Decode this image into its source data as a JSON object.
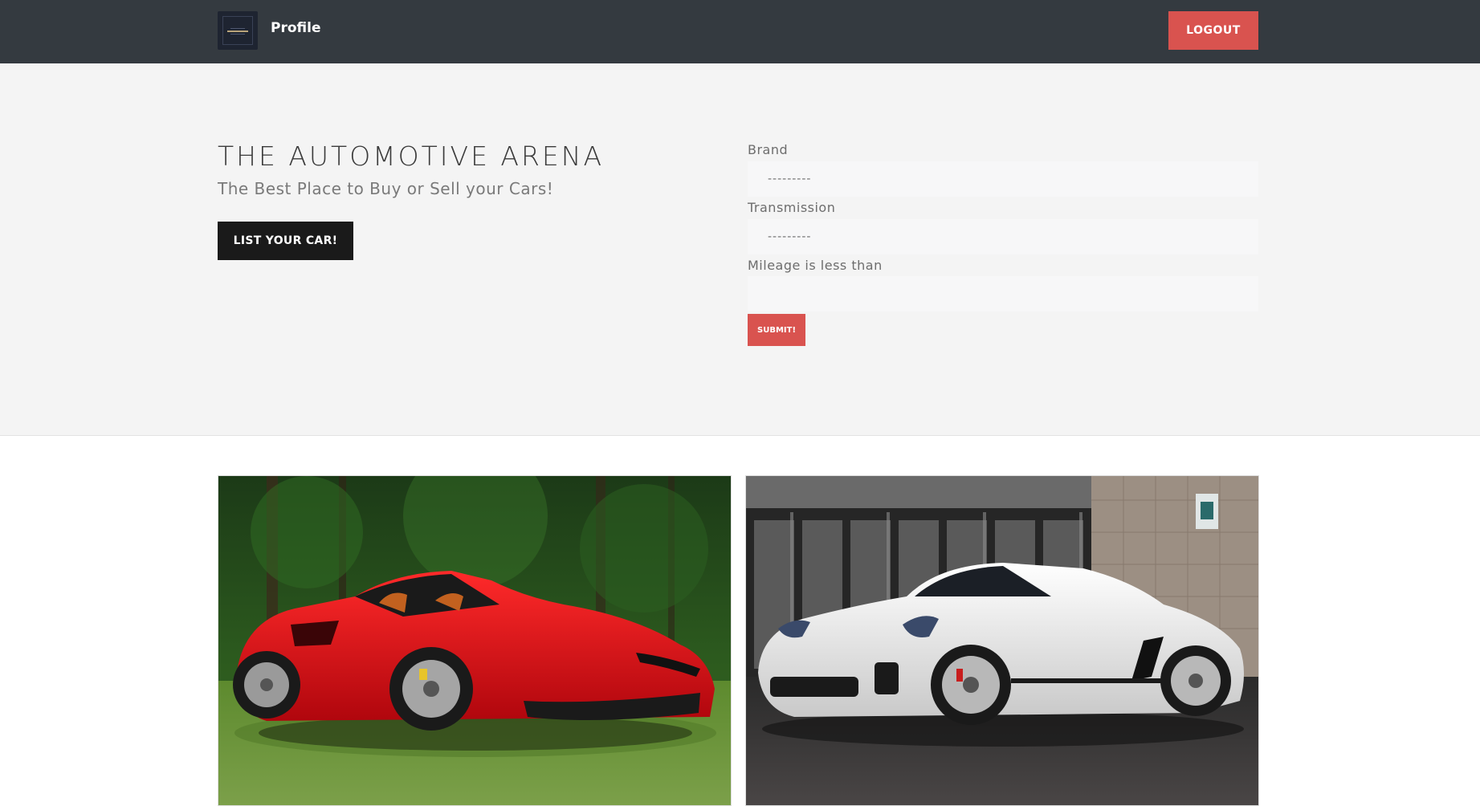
{
  "navbar": {
    "profile_label": "Profile",
    "logout_label": "LOGOUT"
  },
  "hero": {
    "title": "THE AUTOMOTIVE ARENA",
    "subtitle": "The Best Place to Buy or Sell your Cars!",
    "list_car_label": "LIST YOUR CAR!"
  },
  "filter_form": {
    "brand_label": "Brand",
    "brand_value": "---------",
    "transmission_label": "Transmission",
    "transmission_value": "---------",
    "mileage_label": "Mileage is less than",
    "mileage_value": "",
    "submit_label": "SUBMIT!"
  },
  "cars": [
    {
      "image": "red-convertible-sports-car-photo",
      "color": "#e0121b"
    },
    {
      "image": "white-porsche-convertible-photo",
      "color": "#f2f2f2"
    }
  ],
  "colors": {
    "navbar_bg": "#343a40",
    "accent_red": "#d9534f",
    "hero_bg": "#f4f4f4",
    "dark_button": "#1a1a1a"
  }
}
